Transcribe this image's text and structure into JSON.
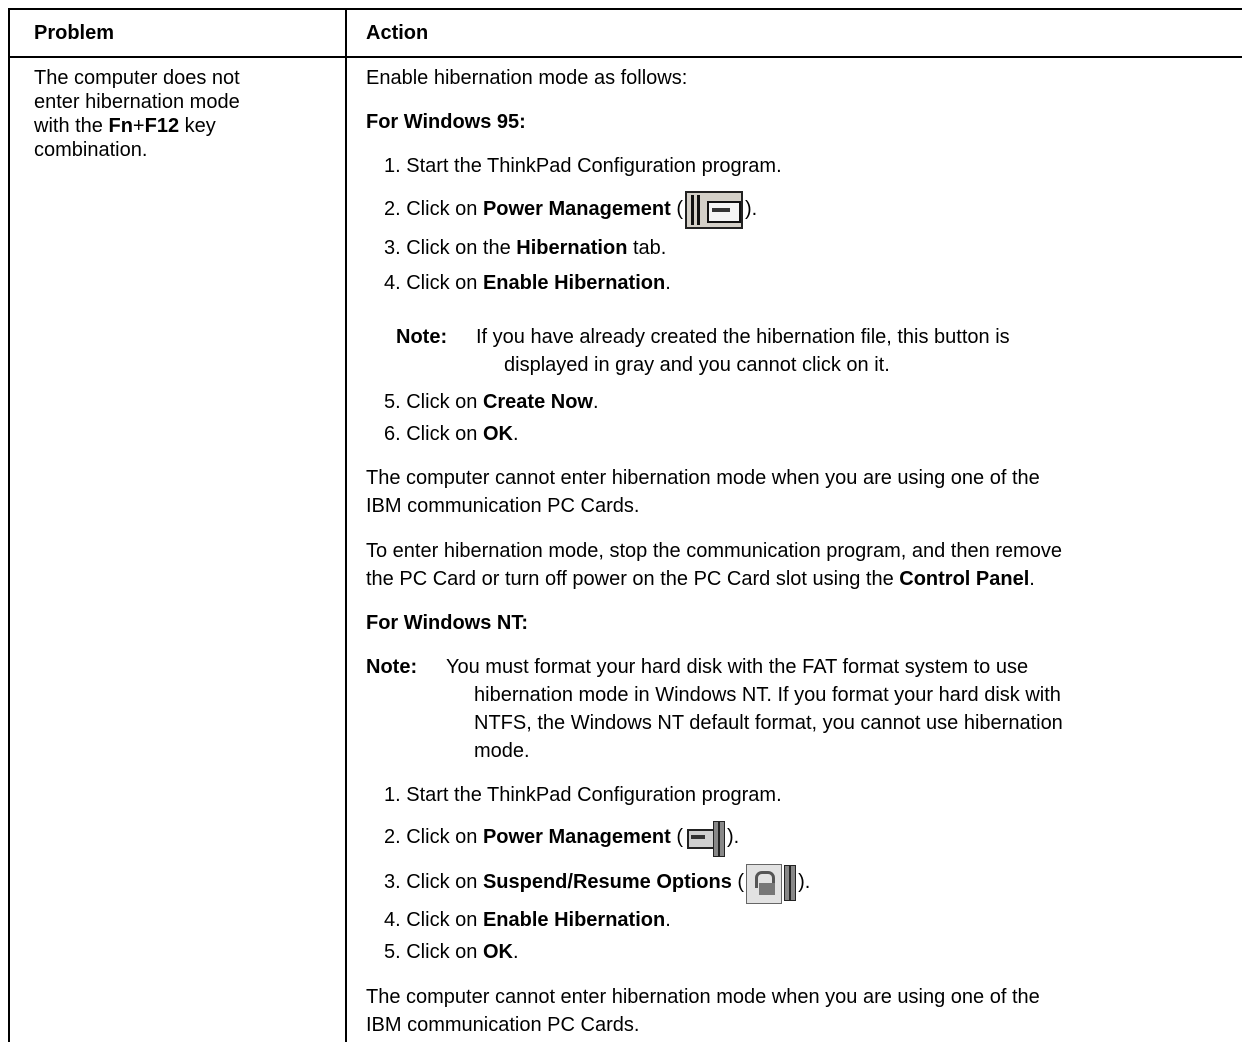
{
  "header": {
    "problem": "Problem",
    "action": "Action"
  },
  "problem_text": {
    "line1": "The computer does not",
    "line2": "enter hibernation mode",
    "line3_prefix": "with the ",
    "key1": "Fn",
    "plus": "+",
    "key2": "F12",
    "line3_suffix": " key",
    "line4": "combination."
  },
  "action": {
    "intro": "Enable hibernation mode as follows:",
    "win95": {
      "heading": "For Windows 95:",
      "step1": "1. Start the ThinkPad Configuration program.",
      "step2_prefix": "2. Click on ",
      "step2_bold": "Power Management",
      "step2_open": " (",
      "step2_close": ").",
      "step3_prefix": "3. Click on the ",
      "step3_bold": "Hibernation",
      "step3_suffix": " tab.",
      "step4_prefix": "4. Click on ",
      "step4_bold": "Enable Hibernation",
      "step4_suffix": ".",
      "note_label": "Note:",
      "note_line1": "If you have already created the hibernation file, this button is",
      "note_line2": "displayed in gray and you cannot click on it.",
      "step5_prefix": "5. Click on ",
      "step5_bold": "Create Now",
      "step5_suffix": ".",
      "step6_prefix": "6. Click on ",
      "step6_bold": "OK",
      "step6_suffix": ".",
      "para1_line1": "The computer cannot enter hibernation mode when you are using one of the",
      "para1_line2": "IBM communication PC Cards.",
      "para2_line1": "To enter hibernation mode, stop the communication program, and then remove",
      "para2_line2_prefix": "the PC Card or turn off power on the PC Card slot using the ",
      "para2_line2_bold": "Control Panel",
      "para2_line2_suffix": "."
    },
    "winnt": {
      "heading": "For Windows NT:",
      "note_label": "Note:",
      "note_line1": "You must format your hard disk with the FAT format system to use",
      "note_line2": "hibernation mode in Windows NT.  If you format your hard disk with",
      "note_line3": "NTFS, the Windows NT default format, you cannot use hibernation",
      "note_line4": "mode.",
      "step1": "1. Start the ThinkPad Configuration program.",
      "step2_prefix": "2. Click on ",
      "step2_bold": "Power Management",
      "step2_open": " (",
      "step2_close": ").",
      "step3_prefix": "3. Click on ",
      "step3_bold": "Suspend/Resume Options",
      "step3_open": " (",
      "step3_close": ").",
      "step4_prefix": "4. Click on ",
      "step4_bold": "Enable Hibernation",
      "step4_suffix": ".",
      "step5_prefix": "5. Click on ",
      "step5_bold": "OK",
      "step5_suffix": ".",
      "para1_line1": "The computer cannot enter hibernation mode when you are using one of the",
      "para1_line2": "IBM communication PC Cards."
    }
  },
  "icons": {
    "win95_power": "power-management-icon",
    "nt_power": "power-management-icon",
    "nt_suspend": "suspend-resume-icon"
  }
}
